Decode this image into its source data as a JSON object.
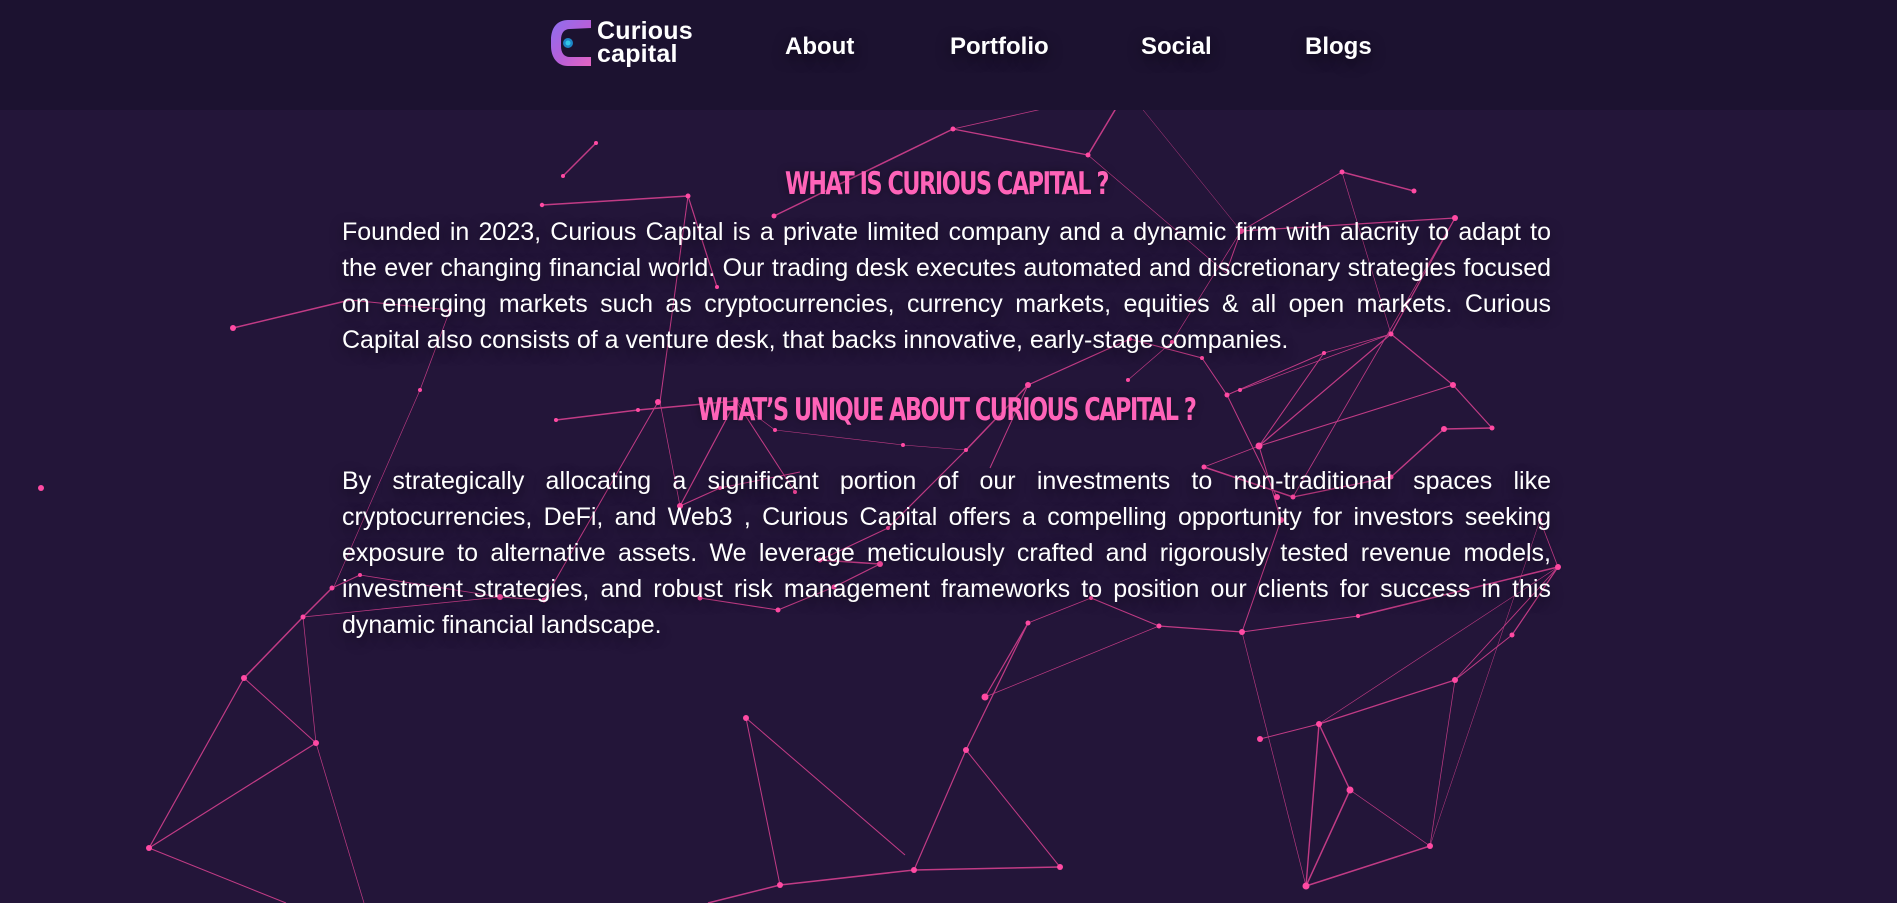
{
  "logo": {
    "line1": "Curious",
    "line2": "capital"
  },
  "navigation": [
    {
      "label": "About"
    },
    {
      "label": "Portfolio"
    },
    {
      "label": "Social"
    },
    {
      "label": "Blogs"
    }
  ],
  "sections": [
    {
      "heading": "WHAT IS CURIOUS CAPITAL ?",
      "body": "Founded in 2023, Curious Capital is a private limited company and a dynamic firm with alacrity to adapt to the ever changing financial world. Our trading desk executes automated and discretionary strategies focused on emerging markets such as cryptocurrencies, currency markets, equities & all open markets. Curious Capital also consists of a venture desk, that backs innovative, early-stage companies."
    },
    {
      "heading": "WHAT’S UNIQUE ABOUT CURIOUS CAPITAL ?",
      "body": "By strategically allocating a significant portion of our investments to non-traditional spaces like cryptocurrencies, DeFi, and Web3 , Curious Capital offers a compelling opportunity for investors seeking exposure to alternative assets. We leverage meticulously crafted and rigorously tested revenue models, investment strategies, and robust risk management frameworks to position our clients for success in this dynamic financial landscape."
    }
  ],
  "colors": {
    "background": "#231539",
    "header": "#1c1230",
    "accent": "#ff63b8",
    "network": "#ff4aa3",
    "text": "#ffffff"
  }
}
